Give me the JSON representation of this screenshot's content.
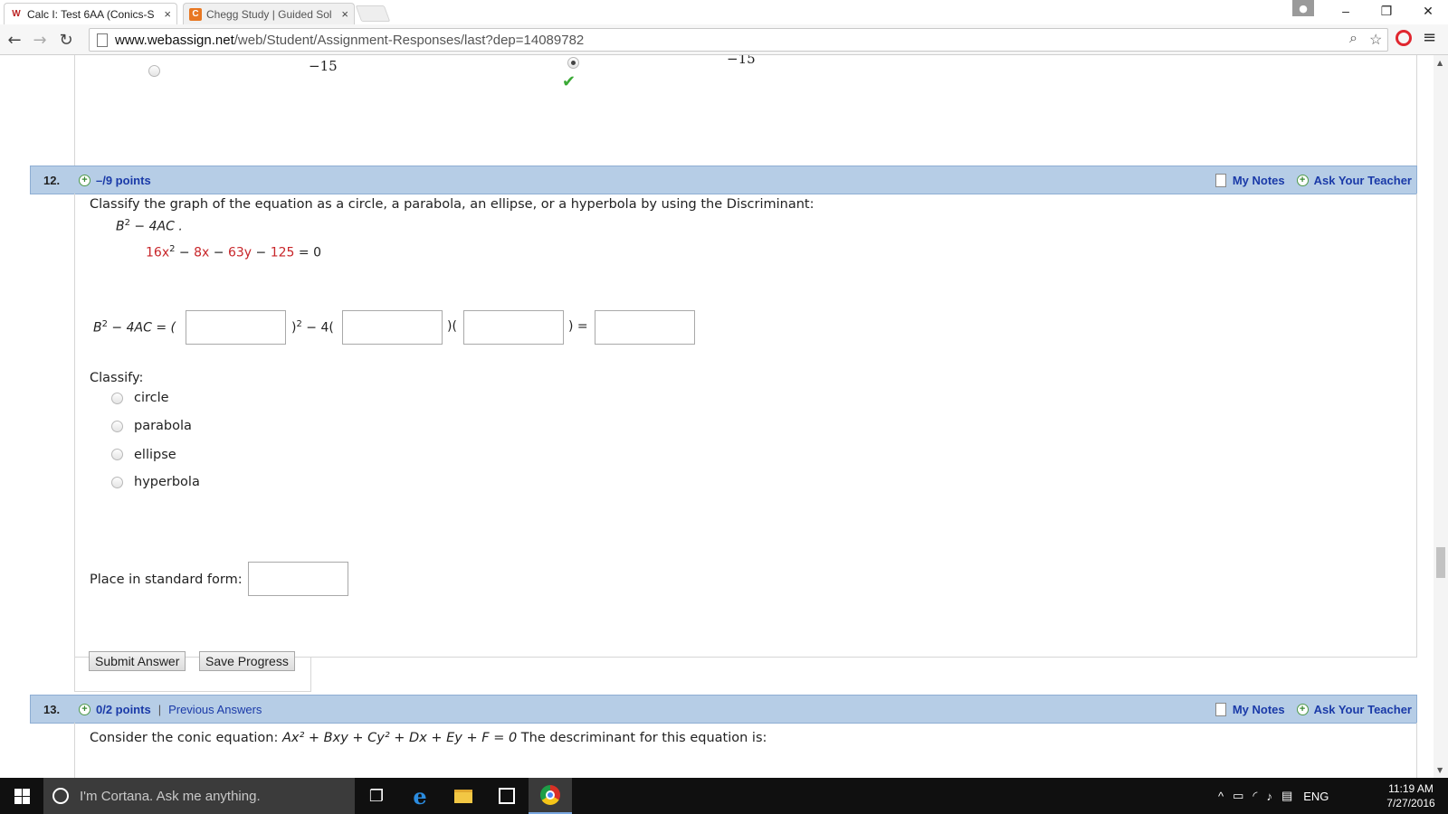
{
  "browser": {
    "tabs": [
      {
        "icon": "W",
        "title": "Calc I: Test 6AA (Conics-S",
        "close": "×"
      },
      {
        "icon": "C",
        "title": "Chegg Study | Guided Sol",
        "close": "×"
      }
    ],
    "window_controls": {
      "minimize": "–",
      "restore": "❐",
      "close": "✕"
    },
    "url_host": "www.webassign.net",
    "url_path": "/web/Student/Assignment-Responses/last?dep=14089782"
  },
  "previous_question": {
    "option_1_value": "−15",
    "option_2_value": "−15"
  },
  "q12": {
    "number": "12.",
    "points": "–/9 points",
    "my_notes": "My Notes",
    "ask_teacher": "Ask Your Teacher",
    "prompt": "Classify the graph of the equation as a circle, a parabola, an ellipse, or a hyperbola by using the Discriminant:",
    "discriminant": "B",
    "discriminant_exp": "2",
    "discriminant_rest": " − 4AC .",
    "equation": {
      "t1": "16x",
      "t1_exp": "2",
      "op1": " − ",
      "t2": "8x",
      "op2": " − ",
      "t3": "63y",
      "op3": " − ",
      "t4": "125",
      "rhs": " = 0"
    },
    "formula": {
      "lhs": "B",
      "lhs_exp": "2",
      "lhs_rest": " − 4AC = (",
      "after_b": ")",
      "after_b_exp": "2",
      "after_b_rest": " − 4(",
      "between": ")(",
      "before_result": ") ="
    },
    "classify_label": "Classify:",
    "options": [
      "circle",
      "parabola",
      "ellipse",
      "hyperbola"
    ],
    "standard_form_label": "Place in standard form:",
    "submit_label": "Submit Answer",
    "save_label": "Save Progress"
  },
  "q13": {
    "number": "13.",
    "points": "0/2 points",
    "separator": "|",
    "previous_answers": "Previous Answers",
    "my_notes": "My Notes",
    "ask_teacher": "Ask Your Teacher",
    "prompt_start": "Consider the conic equation:  ",
    "eq": "Ax² + Bxy + Cy² + Dx + Ey + F = 0",
    "prompt_end": "  The descriminant for this equation is:"
  },
  "taskbar": {
    "cortana_placeholder": "I'm Cortana. Ask me anything.",
    "language": "ENG",
    "time": "11:19 AM",
    "date": "7/27/2016"
  },
  "colors": {
    "header_bg": "#b6cde6",
    "link": "#1a3aa8",
    "coefficient_red": "#c8262a",
    "check_green": "#3aa935"
  }
}
